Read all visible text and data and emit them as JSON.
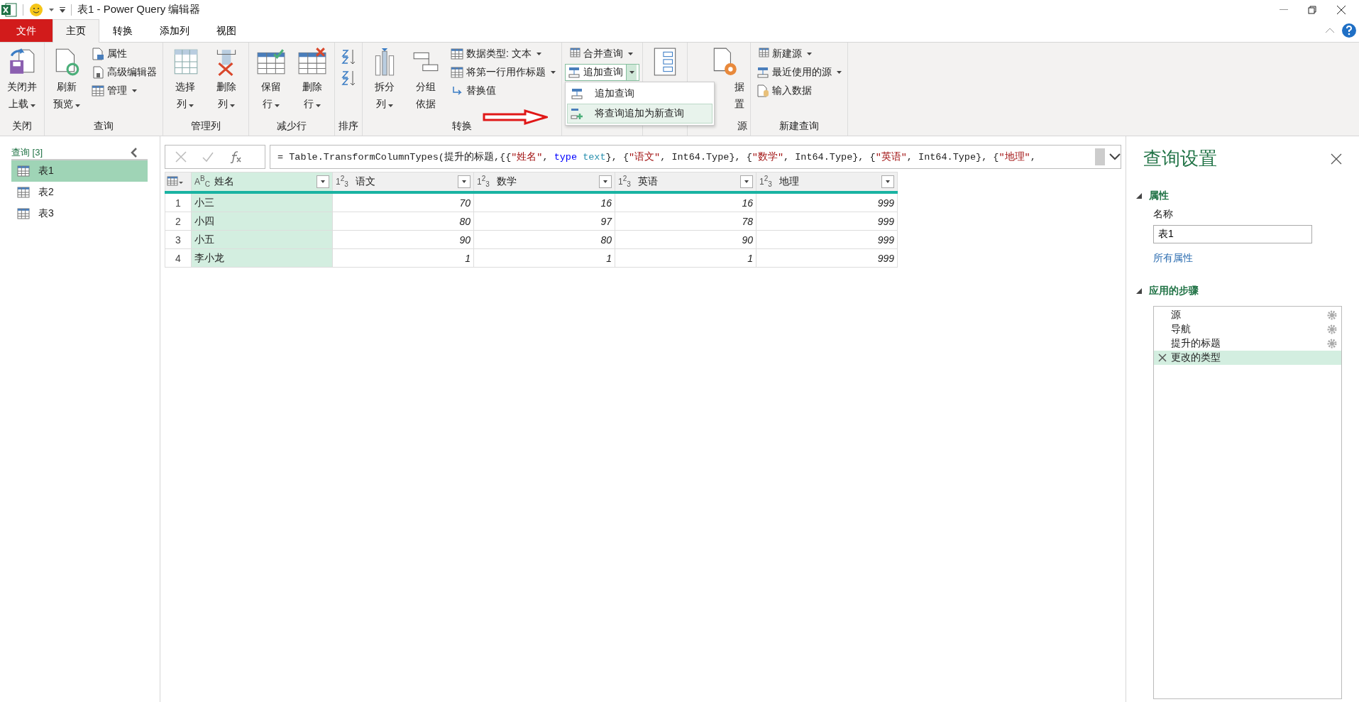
{
  "window": {
    "title": "表1 - Power Query 编辑器"
  },
  "tabs": [
    {
      "label": "文件",
      "kind": "file",
      "selected": false
    },
    {
      "label": "主页",
      "kind": "tab",
      "selected": true
    },
    {
      "label": "转换",
      "kind": "tab",
      "selected": false
    },
    {
      "label": "添加列",
      "kind": "tab",
      "selected": false
    },
    {
      "label": "视图",
      "kind": "tab",
      "selected": false
    }
  ],
  "ribbon": {
    "groups": [
      {
        "label": "关闭",
        "items": [
          {
            "kind": "large",
            "lines": [
              "关闭并",
              "上载"
            ],
            "dropdown": true
          }
        ]
      },
      {
        "label": "查询",
        "items": [
          {
            "kind": "large",
            "lines": [
              "刷新",
              "预览"
            ],
            "dropdown": true
          },
          {
            "kind": "stack",
            "items": [
              {
                "label": "属性",
                "dropdown": false
              },
              {
                "label": "高级编辑器",
                "dropdown": false
              },
              {
                "label": "管理",
                "dropdown": true
              }
            ]
          }
        ]
      },
      {
        "label": "管理列",
        "items": [
          {
            "kind": "large",
            "lines": [
              "选择",
              "列"
            ],
            "dropdown": true
          },
          {
            "kind": "large",
            "lines": [
              "删除",
              "列"
            ],
            "dropdown": true
          }
        ]
      },
      {
        "label": "减少行",
        "items": [
          {
            "kind": "large",
            "lines": [
              "保留",
              "行"
            ],
            "dropdown": true
          },
          {
            "kind": "large",
            "lines": [
              "删除",
              "行"
            ],
            "dropdown": true
          }
        ]
      },
      {
        "label": "排序",
        "items": [
          {
            "kind": "sort"
          }
        ]
      },
      {
        "label": "转换",
        "items": [
          {
            "kind": "large",
            "lines": [
              "拆分",
              "列"
            ],
            "dropdown": true
          },
          {
            "kind": "large",
            "lines": [
              "分组",
              "依据"
            ],
            "dropdown": false
          },
          {
            "kind": "stack",
            "items": [
              {
                "label": "数据类型: 文本",
                "dropdown": true
              },
              {
                "label": "将第一行用作标题",
                "dropdown": true
              },
              {
                "label": "替换值",
                "dropdown": false
              }
            ]
          }
        ]
      },
      {
        "items": [
          {
            "kind": "combine",
            "merge": {
              "label": "合并查询",
              "dropdown": true
            },
            "append": {
              "label": "追加查询",
              "open": true
            },
            "menu": [
              {
                "label": "追加查询",
                "selected": false
              },
              {
                "label": "将查询追加为新查询",
                "selected": true
              }
            ]
          }
        ]
      },
      {
        "items": [
          {
            "kind": "covered"
          }
        ]
      },
      {
        "label": "源",
        "items": [
          {
            "kind": "partial",
            "lines": [
              "据",
              "置"
            ]
          }
        ]
      },
      {
        "label": "新建查询",
        "items": [
          {
            "kind": "stack",
            "items": [
              {
                "label": "新建源",
                "dropdown": true
              },
              {
                "label": "最近使用的源",
                "dropdown": true
              },
              {
                "label": "输入数据",
                "dropdown": false
              }
            ]
          }
        ]
      }
    ]
  },
  "queries": {
    "header": "查询 [3]",
    "items": [
      {
        "label": "表1",
        "selected": true
      },
      {
        "label": "表2",
        "selected": false
      },
      {
        "label": "表3",
        "selected": false
      }
    ]
  },
  "formula": [
    {
      "kind": "plain",
      "text": "= Table.TransformColumnTypes(提升的标题,{{"
    },
    {
      "kind": "string",
      "text": "\"姓名\""
    },
    {
      "kind": "plain",
      "text": ", "
    },
    {
      "kind": "keyword",
      "text": "type "
    },
    {
      "kind": "type",
      "text": "text"
    },
    {
      "kind": "plain",
      "text": "}, {"
    },
    {
      "kind": "string",
      "text": "\"语文\""
    },
    {
      "kind": "plain",
      "text": ", Int64.Type}, {"
    },
    {
      "kind": "string",
      "text": "\"数学\""
    },
    {
      "kind": "plain",
      "text": ", Int64.Type}, {"
    },
    {
      "kind": "string",
      "text": "\"英语\""
    },
    {
      "kind": "plain",
      "text": ", Int64.Type}, {"
    },
    {
      "kind": "string",
      "text": "\"地理\""
    },
    {
      "kind": "plain",
      "text": ","
    }
  ],
  "table": {
    "columns": [
      {
        "name": "姓名",
        "type_label": "A$^{B}$$_{C}$",
        "kind": "text",
        "selected": true
      },
      {
        "name": "语文",
        "type_label": "1$^{2}$$_{3}$",
        "kind": "number",
        "selected": false
      },
      {
        "name": "数学",
        "type_label": "1$^{2}$$_{3}$",
        "kind": "number",
        "selected": false
      },
      {
        "name": "英语",
        "type_label": "1$^{2}$$_{3}$",
        "kind": "number",
        "selected": false
      },
      {
        "name": "地理",
        "type_label": "1$^{2}$$_{3}$",
        "kind": "number",
        "selected": false
      }
    ],
    "rows": [
      {
        "index": "1",
        "cells": [
          "小三",
          "70",
          "16",
          "16",
          "999"
        ]
      },
      {
        "index": "2",
        "cells": [
          "小四",
          "80",
          "97",
          "78",
          "999"
        ]
      },
      {
        "index": "3",
        "cells": [
          "小五",
          "90",
          "80",
          "90",
          "999"
        ]
      },
      {
        "index": "4",
        "cells": [
          "李小龙",
          "1",
          "1",
          "1",
          "999"
        ]
      }
    ]
  },
  "settings": {
    "title": "查询设置",
    "properties_heading": "属性",
    "name_label": "名称",
    "name_value": "表1",
    "all_properties": "所有属性",
    "steps_heading": "应用的步骤",
    "steps": [
      {
        "label": "源",
        "selected": false,
        "settings": true
      },
      {
        "label": "导航",
        "selected": false,
        "settings": true
      },
      {
        "label": "提升的标题",
        "selected": false,
        "settings": true
      },
      {
        "label": "更改的类型",
        "selected": true,
        "settings": false
      }
    ]
  }
}
